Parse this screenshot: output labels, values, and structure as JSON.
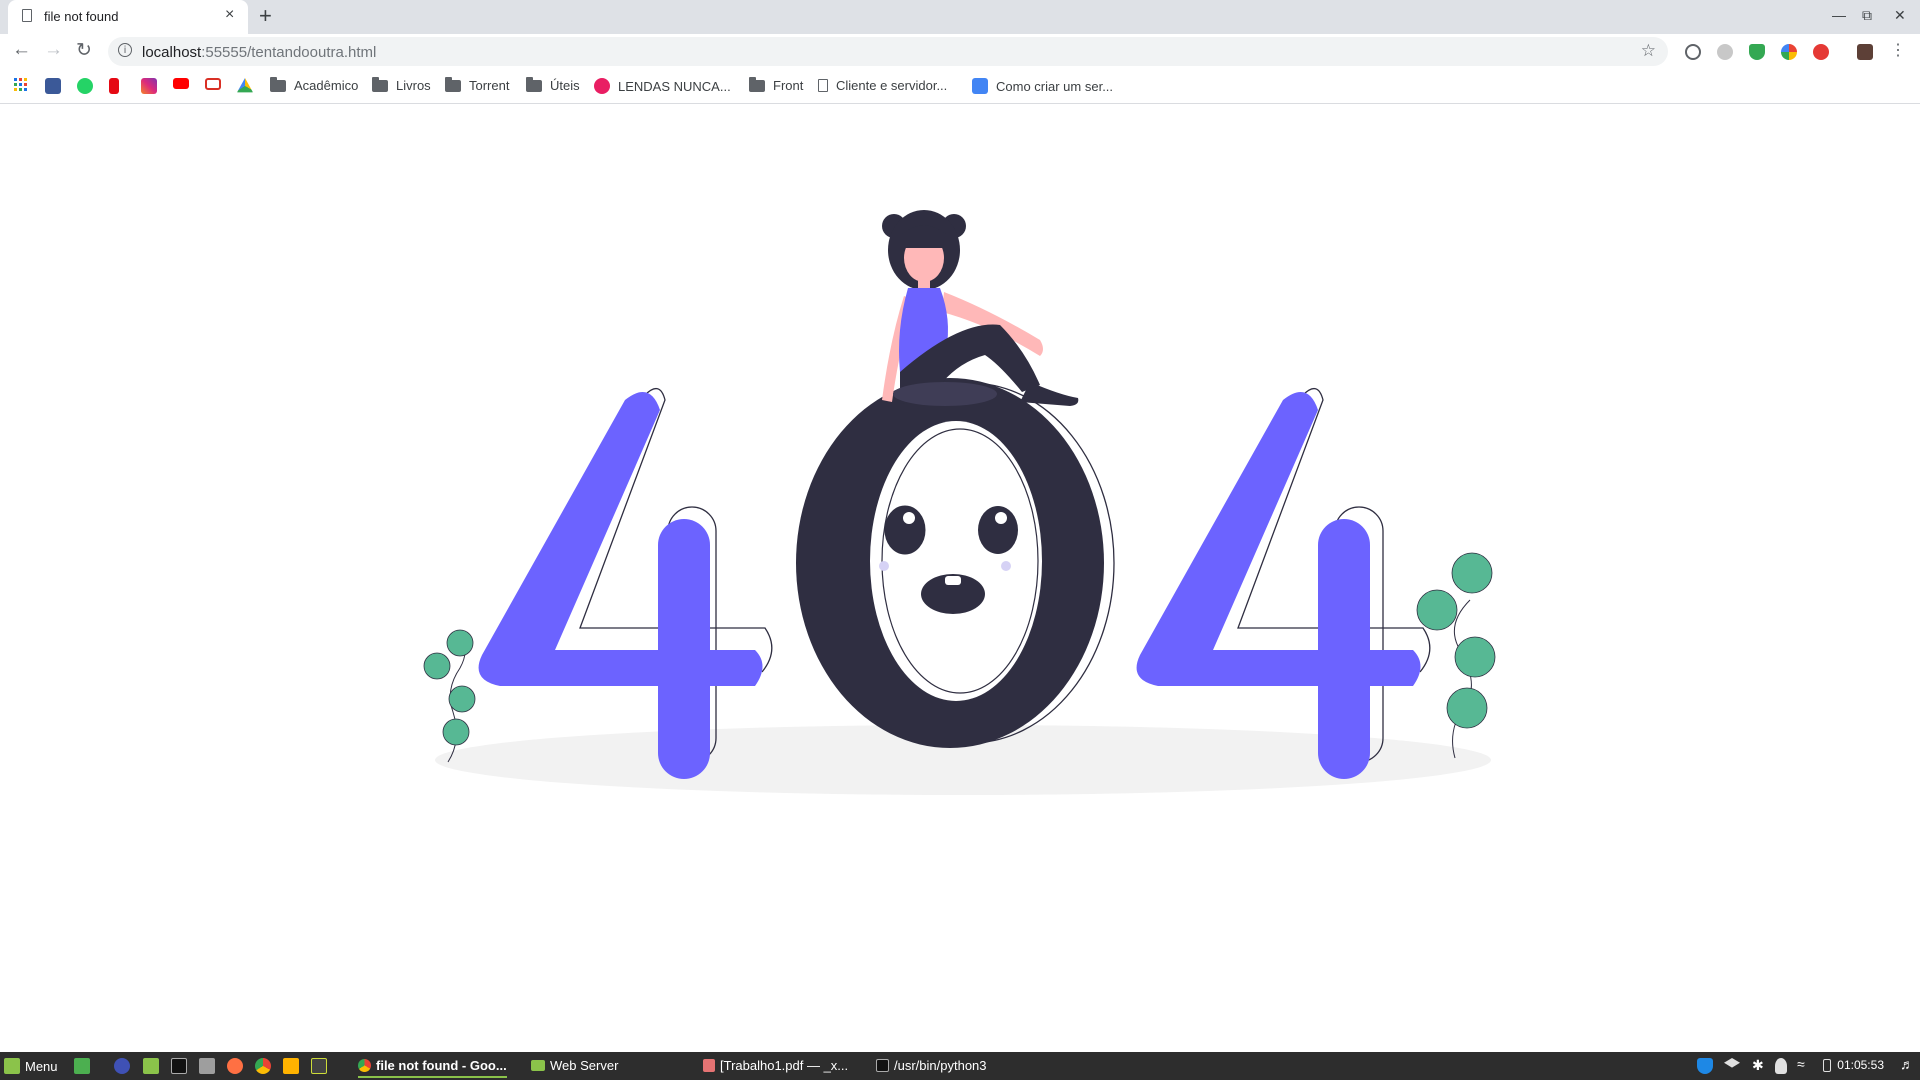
{
  "browser": {
    "tab_title": "file not found",
    "tab_close": "×",
    "new_tab": "+",
    "url_host": "localhost",
    "url_rest": ":55555/tentandooutra.html"
  },
  "bookmarks": [
    {
      "label": "Acadêmico",
      "icon": "folder-icon"
    },
    {
      "label": "Livros",
      "icon": "folder-icon"
    },
    {
      "label": "Torrent",
      "icon": "folder-icon"
    },
    {
      "label": "Úteis",
      "icon": "folder-icon"
    },
    {
      "label": "LENDAS NUNCA...",
      "icon": "lendas-icon"
    },
    {
      "label": "Front",
      "icon": "folder-icon"
    },
    {
      "label": "Cliente e servidor...",
      "icon": "page-icon"
    },
    {
      "label": "Como criar um ser...",
      "icon": "site-icon"
    }
  ],
  "page": {
    "illustration": "404 illustration"
  },
  "taskbar": {
    "menu_label": "Menu",
    "tasks": [
      {
        "label": "file not found - Goo...",
        "icon": "chrome-icon"
      },
      {
        "label": "Web Server",
        "icon": "folder-icon"
      },
      {
        "label": "[Trabalho1.pdf — _x...",
        "icon": "pdf-icon"
      },
      {
        "label": "/usr/bin/python3",
        "icon": "terminal-icon"
      }
    ],
    "clock": "01:05:53"
  },
  "colors": {
    "accent": "#6c63ff",
    "dark": "#2f2e41",
    "leaf": "#57b894",
    "shadow": "#f2f2f2",
    "skin": "#ffb8b8"
  }
}
